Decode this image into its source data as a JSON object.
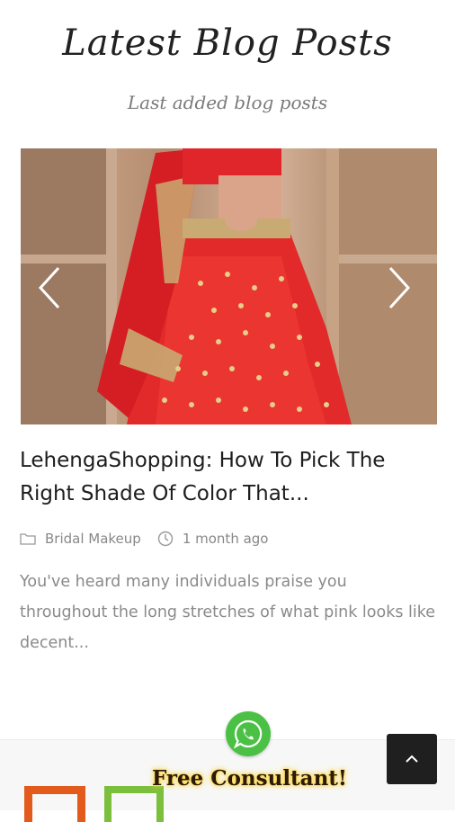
{
  "section": {
    "title": "Latest Blog Posts",
    "subtitle": "Last added blog posts"
  },
  "post": {
    "title": "LehengaShopping: How To Pick The Right Shade Of Color That...",
    "category": "Bridal Makeup",
    "date": "1 month ago",
    "excerpt": "You've heard many individuals praise you throughout the long stretches of what pink looks like decent..."
  },
  "carousel": {
    "prev_icon": "chevron-left-icon",
    "next_icon": "chevron-right-icon"
  },
  "floating": {
    "consult_label": "Free Consultant!",
    "whatsapp_icon": "whatsapp-icon",
    "to_top_icon": "chevron-up-icon"
  },
  "colors": {
    "accent_orange": "#e25a1c",
    "accent_green": "#7cbf3c",
    "whatsapp_green": "#4ac144",
    "lehenga_red": "#e22a2a"
  }
}
